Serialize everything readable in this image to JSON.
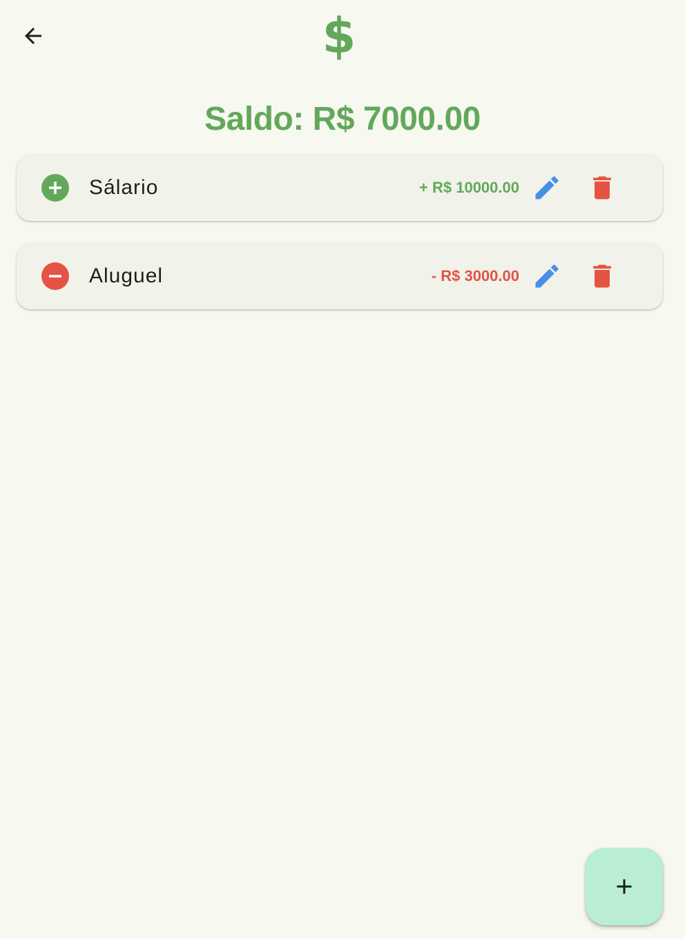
{
  "app_bar": {
    "back_icon": "arrow-back-icon",
    "logo_icon": "dollar-sign-icon",
    "logo_text": "$"
  },
  "balance": {
    "text": "Saldo: R$ 7000.00"
  },
  "transactions": [
    {
      "name": "Sálario",
      "amount": "+ R$ 10000.00",
      "type": "income",
      "type_icon": "add-circle-icon"
    },
    {
      "name": "Aluguel",
      "amount": "- R$ 3000.00",
      "type": "expense",
      "type_icon": "remove-circle-icon"
    }
  ],
  "actions": {
    "edit_icon": "pencil-icon",
    "delete_icon": "trash-icon"
  },
  "fab": {
    "icon": "plus-icon"
  },
  "colors": {
    "background": "#f7f9f1",
    "card": "#f1f3eb",
    "income": "#63a85a",
    "expense": "#e55344",
    "edit": "#4a8fe7",
    "fab": "#b9eed5"
  }
}
